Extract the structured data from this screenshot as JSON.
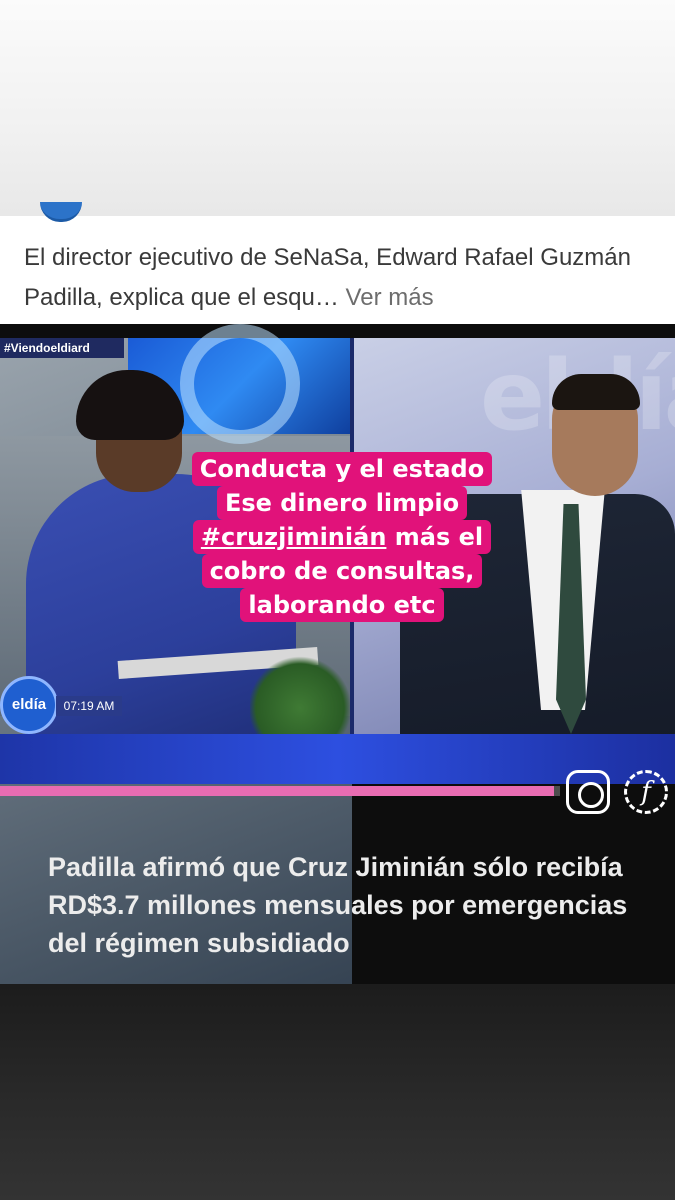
{
  "post": {
    "text": "El director ejecutivo de SeNaSa, Edward Rafael Guzmán Padilla, explica que el esqu…",
    "see_more": "Ver más"
  },
  "video": {
    "hashtag": "#Viendoeldiard",
    "channel_logo": "eldía",
    "time": "07:19 AM",
    "progress_fraction": 0.99,
    "caption": "Padilla afirmó que Cruz Jiminián sólo recibía RD$3.7 millones mensuales por emergencias del régimen subsidiado",
    "icons": [
      "instagram-icon",
      "facebook-icon"
    ]
  },
  "sticker": {
    "line1": "Conducta y el estado",
    "line2": "Ese dinero limpio",
    "line3_tag": "#cruzjiminián",
    "line3_rest": " más el",
    "line4": "cobro de consultas,",
    "line5": "laborando etc",
    "color": "#e1127a"
  }
}
